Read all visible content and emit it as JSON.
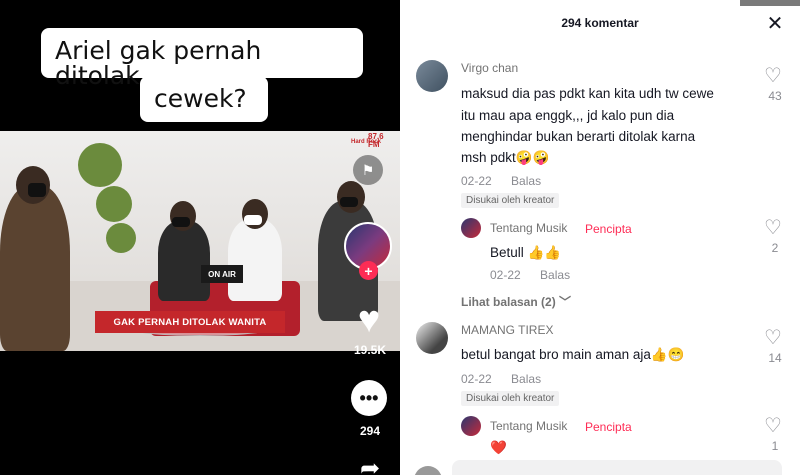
{
  "video": {
    "caption_line1": "Ariel gak pernah ditolak",
    "caption_line2": "cewek?",
    "station_brand": "Hard Rock",
    "station_freq": "87.6 FM",
    "onair_sign": "ON AIR",
    "lower_third": "GAK PERNAH DITOLAK WANITA",
    "like_count": "19.5K",
    "comment_count": "294"
  },
  "panel": {
    "title": "294 komentar",
    "close_glyph": "✕"
  },
  "comments": [
    {
      "username": "Virgo chan",
      "text_lines": [
        "maksud dia pas pdkt kan kita udh tw cewe",
        "itu mau apa enggk,,, jd kalo pun dia",
        "menghindar bukan berarti ditolak karna",
        "msh pdkt🤪🤪"
      ],
      "date": "02-22",
      "reply_label": "Balas",
      "liked_by_creator": "Disukai oleh kreator",
      "likes": "43"
    },
    {
      "username": "Tentang Musik",
      "creator_tag": "Pencipta",
      "text": "Betull 👍👍",
      "date": "02-22",
      "reply_label": "Balas",
      "likes": "2"
    },
    {
      "view_replies": "Lihat balasan (2)"
    },
    {
      "username": "MAMANG TIREX",
      "text": "betul bangat bro main aman aja👍😁",
      "date": "02-22",
      "reply_label": "Balas",
      "liked_by_creator": "Disukai oleh kreator",
      "likes": "14"
    },
    {
      "username": "Tentang Musik",
      "creator_tag": "Pencipta",
      "text": "❤️",
      "likes": "1"
    }
  ],
  "icons": {
    "heart": "heart-outline-icon",
    "close": "close-icon",
    "chevron": "chevron-down-icon"
  },
  "colors": {
    "accent": "#fe2c55",
    "lower_third": "#c4272b"
  }
}
